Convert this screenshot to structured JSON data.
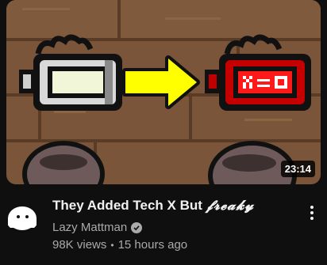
{
  "video": {
    "duration": "23:14",
    "title_main": "They Added Tech X But",
    "title_fancy": "𝓯𝓻𝓮𝓪𝓴𝔂",
    "channel": "Lazy Mattman",
    "views": "98K views",
    "separator": "•",
    "age": "15 hours ago"
  },
  "icons": {
    "verified": "verified-check-icon",
    "more": "more-vert-icon"
  },
  "colors": {
    "background": "#0f0f0f",
    "title": "#f1f1f1",
    "secondary": "#aaaaaa",
    "arrow": "#ffff00",
    "wood": "#7a5438",
    "battery_red": "#e00000"
  }
}
